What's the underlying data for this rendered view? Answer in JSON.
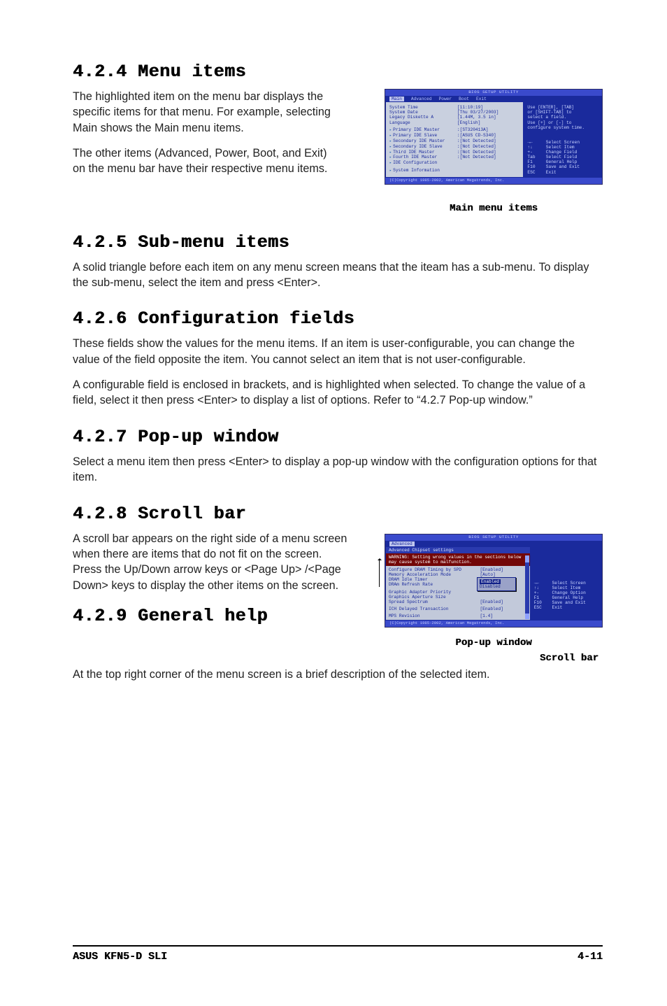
{
  "sections": {
    "s424": {
      "heading": "4.2.4   Menu items",
      "p1": "The highlighted item on the menu bar displays the specific items for that menu. For example, selecting Main shows the Main menu items.",
      "p2": "The other items (Advanced, Power, Boot, and Exit) on the menu bar have their respective menu items."
    },
    "s425": {
      "heading": "4.2.5   Sub-menu items",
      "p1": "A solid triangle before each item on any menu screen means that the iteam has a sub-menu. To display the sub-menu, select the item and press <Enter>."
    },
    "s426": {
      "heading": "4.2.6   Configuration fields",
      "p1": "These fields show the values for the menu items. If an item is user-configurable, you can change the value of the field opposite the item. You cannot select an item that is not user-configurable.",
      "p2": "A configurable field is enclosed in brackets, and is highlighted when selected. To change the value of a field, select it then press <Enter> to display a list of options. Refer to “4.2.7 Pop-up window.”"
    },
    "s427": {
      "heading": "4.2.7   Pop-up window",
      "p1": "Select a menu item then press <Enter> to display a pop-up window with the configuration options for that item."
    },
    "s428": {
      "heading": "4.2.8   Scroll bar",
      "p1": "A scroll bar appears on the right side of a menu screen when there are items that do not fit on the screen. Press the Up/Down arrow keys or <Page Up> /<Page Down> keys to display the other items on the screen."
    },
    "s429": {
      "heading": "4.2.9   General help",
      "p1": "At the top right corner of the menu screen is a brief description of the selected item."
    }
  },
  "fig1": {
    "caption": "Main menu items",
    "title": "BIOS SETUP UTILITY",
    "menubar": [
      "Main",
      "Advanced",
      "Power",
      "Boot",
      "Exit"
    ],
    "left_rows": [
      {
        "label": "System Time",
        "value": "[11:10:19]"
      },
      {
        "label": "System Date",
        "value": "[Thu 03/27/2003]"
      },
      {
        "label": "Legacy Diskette A",
        "value": "[1.44M, 3.5 in]"
      },
      {
        "label": "Language",
        "value": "[English]"
      }
    ],
    "left_sub": [
      {
        "label": "Primary IDE Master",
        "value": ":[ST320413A]"
      },
      {
        "label": "Primary IDE Slave",
        "value": ":[ASUS CD-S340]"
      },
      {
        "label": "Secondary IDE Master",
        "value": ":[Not Detected]"
      },
      {
        "label": "Secondary IDE Slave",
        "value": ":[Not Detected]"
      },
      {
        "label": "Third IDE Master",
        "value": ":[Not Detected]"
      },
      {
        "label": "Fourth IDE Master",
        "value": ":[Not Detected]"
      },
      {
        "label": "IDE Configuration",
        "value": ""
      }
    ],
    "left_bottom": "System Information",
    "help_top": [
      "Use [ENTER], [TAB]",
      "or [SHIFT-TAB] to",
      "select a field.",
      "",
      "Use [+] or [-] to",
      "configure system time."
    ],
    "help_keys": [
      {
        "k": "→←",
        "v": "Select Screen"
      },
      {
        "k": "↑↓",
        "v": "Select Item"
      },
      {
        "k": "+-",
        "v": "Change Field"
      },
      {
        "k": "Tab",
        "v": "Select Field"
      },
      {
        "k": "F1",
        "v": "General Help"
      },
      {
        "k": "F10",
        "v": "Save and Exit"
      },
      {
        "k": "ESC",
        "v": "Exit"
      }
    ],
    "bottom": "(C)Copyright 1985-2002, American Megatrends, Inc."
  },
  "fig2": {
    "caption1": "Pop-up window",
    "caption2": "Scroll bar",
    "title": "BIOS SETUP UTILITY",
    "menubar_sel": "Advanced",
    "subtitle": "Advanced Chipset settings",
    "warning": "WARNING: Setting wrong values in the sections below may cause system to malfunction.",
    "fields": [
      {
        "label": "Configure DRAM Timing by SPD",
        "value": "[Enabled]"
      },
      {
        "label": "Memory Acceleration Mode",
        "value": "[Auto]"
      },
      {
        "label": "DRAM Idle Timer",
        "value": ""
      },
      {
        "label": "DRAm Refresh Rate",
        "value": ""
      },
      {
        "label": "",
        "value": ""
      },
      {
        "label": "Graphic Adapter Priority",
        "value": ""
      },
      {
        "label": "Graphics Aperture Size",
        "value": ""
      },
      {
        "label": "Spread Spectrum",
        "value": "[Enabled]"
      },
      {
        "label": "",
        "value": ""
      },
      {
        "label": "ICH Delayed Transaction",
        "value": "[Enabled]"
      },
      {
        "label": "",
        "value": ""
      },
      {
        "label": "MPS Revision",
        "value": "[1.4]"
      }
    ],
    "popup": {
      "opt1": "Enabled",
      "opt2": "Disabled"
    },
    "help_keys": [
      {
        "k": "→←",
        "v": "Select Screen"
      },
      {
        "k": "↑↓",
        "v": "Select Item"
      },
      {
        "k": "+-",
        "v": "Change Option"
      },
      {
        "k": "F1",
        "v": "General Help"
      },
      {
        "k": "F10",
        "v": "Save and Exit"
      },
      {
        "k": "ESC",
        "v": "Exit"
      }
    ],
    "bottom": "(C)Copyright 1985-2002, American Megatrends, Inc."
  },
  "footer": {
    "left": "ASUS KFN5-D SLI",
    "right": "4-11"
  }
}
